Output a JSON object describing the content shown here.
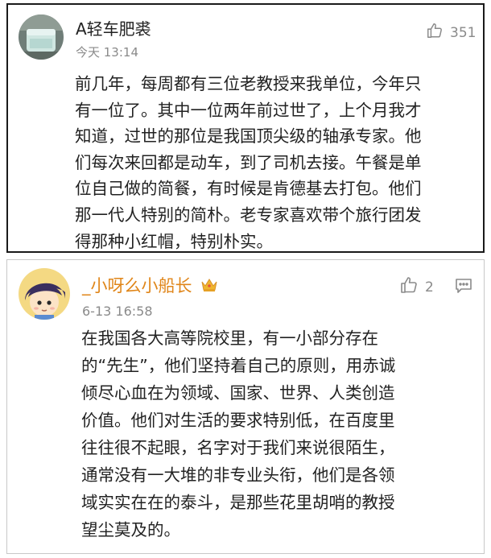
{
  "comments": [
    {
      "username": "A轻车肥裘",
      "time": "今天 13:14",
      "likes": "351",
      "lines": [
        "前几年，每周都有三位老教授来我单位，今年只",
        "有一位了。其中一位两年前过世了，上个月我才",
        "知道，过世的那位是我国顶尖级的轴承专家。他",
        "们每次来回都是动车，到了司机去接。午餐是单",
        "位自己做的简餐，有时候是肯德基去打包。他们",
        "那一代人特别的简朴。老专家喜欢带个旅行团发",
        "得那种小红帽，特别朴实。"
      ]
    },
    {
      "username": "_小呀么小船长",
      "time": "6-13 16:58",
      "likes": "2",
      "lines": [
        "在我国各大高等院校里，有一小部分存在",
        "的“先生”，他们坚持着自己的原则，用赤诚",
        "倾尽心血在为领域、国家、世界、人类创造",
        "价值。他们对生活的要求特别低，在百度里",
        "往往很不起眼，名字对于我们来说很陌生，",
        "通常没有一大堆的非专业头衔，他们是各领",
        "域实实在在的泰斗，是那些花里胡哨的教授",
        "望尘莫及的。"
      ]
    }
  ],
  "icons": {
    "like": "thumbs-up-icon",
    "comment": "comment-icon",
    "badge": "crown-badge-icon"
  },
  "colors": {
    "username_highlight": "#e0861a",
    "meta_gray": "#8a8a8a",
    "text": "#222222"
  }
}
